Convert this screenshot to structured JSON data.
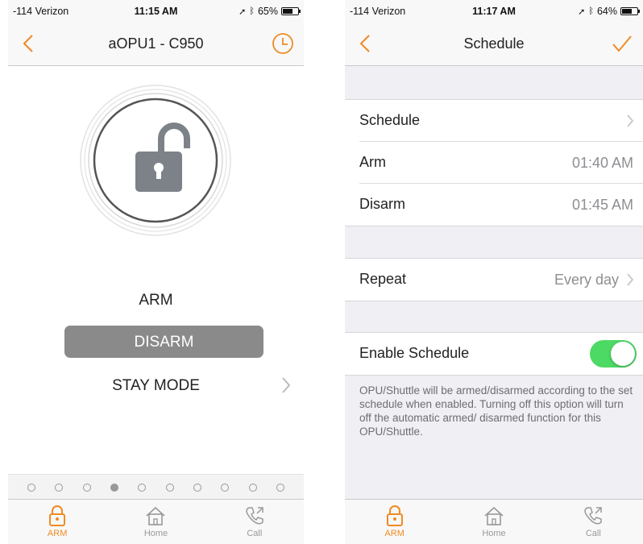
{
  "left": {
    "status": {
      "carrier": "-114 Verizon",
      "time": "11:15 AM",
      "battery": "65%",
      "battery_level": 0.65
    },
    "nav": {
      "title": "aOPU1 - C950"
    },
    "modes": {
      "arm": "ARM",
      "disarm": "DISARM",
      "stay": "STAY MODE"
    },
    "page_dots": {
      "count": 10,
      "active_index": 3
    },
    "tabs": [
      {
        "label": "ARM",
        "active": true
      },
      {
        "label": "Home",
        "active": false
      },
      {
        "label": "Call",
        "active": false
      }
    ]
  },
  "right": {
    "status": {
      "carrier": "-114 Verizon",
      "time": "11:17 AM",
      "battery": "64%",
      "battery_level": 0.64
    },
    "nav": {
      "title": "Schedule"
    },
    "schedule_group": [
      {
        "label": "Schedule",
        "value": ""
      },
      {
        "label": "Arm",
        "value": "01:40 AM"
      },
      {
        "label": "Disarm",
        "value": "01:45 AM"
      }
    ],
    "repeat": {
      "label": "Repeat",
      "value": "Every day"
    },
    "enable": {
      "label": "Enable Schedule",
      "on": true
    },
    "footnote": "OPU/Shuttle will be armed/disarmed according to the set schedule when enabled. Turning off this option will turn off the automatic armed/ disarmed function for this OPU/Shuttle.",
    "tabs": [
      {
        "label": "ARM",
        "active": true
      },
      {
        "label": "Home",
        "active": false
      },
      {
        "label": "Call",
        "active": false
      }
    ]
  },
  "colors": {
    "accent": "#f08a24",
    "toggle_on": "#4cd964",
    "disarm_bg": "#8a8a8a"
  }
}
